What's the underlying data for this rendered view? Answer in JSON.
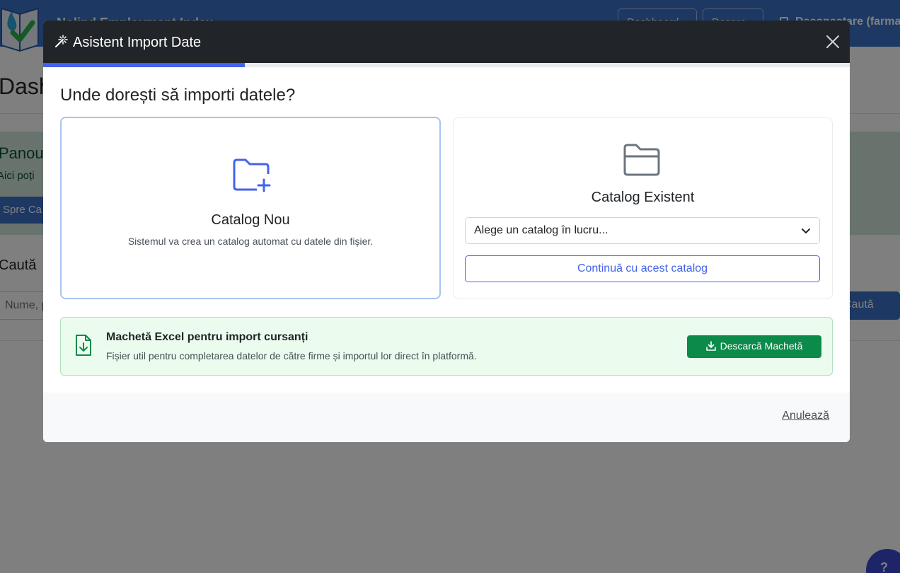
{
  "background": {
    "brand": "Nolind Employment Index",
    "nav_button_1": "Dashboard",
    "nav_button_2": "Despre",
    "user": "Deconectare (farmacie)",
    "page_title": "Dashboard",
    "panel_title": "Panou",
    "panel_text": "Aici poți",
    "panel_button": "Spre Ca",
    "search_title": "Caută",
    "search_placeholder": "Nume, p",
    "search_button": "Caută",
    "help": "?"
  },
  "modal": {
    "title": "Asistent Import Date",
    "progress_percent": 25,
    "question": "Unde dorești să importi datele?",
    "new_catalog": {
      "title": "Catalog Nou",
      "description": "Sistemul va crea un catalog automat cu datele din fișier."
    },
    "existing_catalog": {
      "title": "Catalog Existent",
      "select_value": "Alege un catalog în lucru...",
      "continue_label": "Continuă cu acest catalog"
    },
    "template": {
      "title": "Machetă Excel pentru import cursanți",
      "description": "Fișier util pentru completarea datelor de către firme și importul lor direct în platformă.",
      "download_label": "Descarcă Machetă"
    },
    "cancel_label": "Anulează"
  },
  "colors": {
    "header_dark": "#212529",
    "accent": "#4263eb",
    "success": "#0c8a4a",
    "navbar": "#3b70c6"
  },
  "icons": {
    "title_icon": "magic-wand-icon",
    "close": "close-icon",
    "new_catalog": "folder-plus-icon",
    "existing_catalog": "folder-icon",
    "select": "chevron-down-icon",
    "template": "file-download-icon",
    "download_button": "download-icon"
  }
}
